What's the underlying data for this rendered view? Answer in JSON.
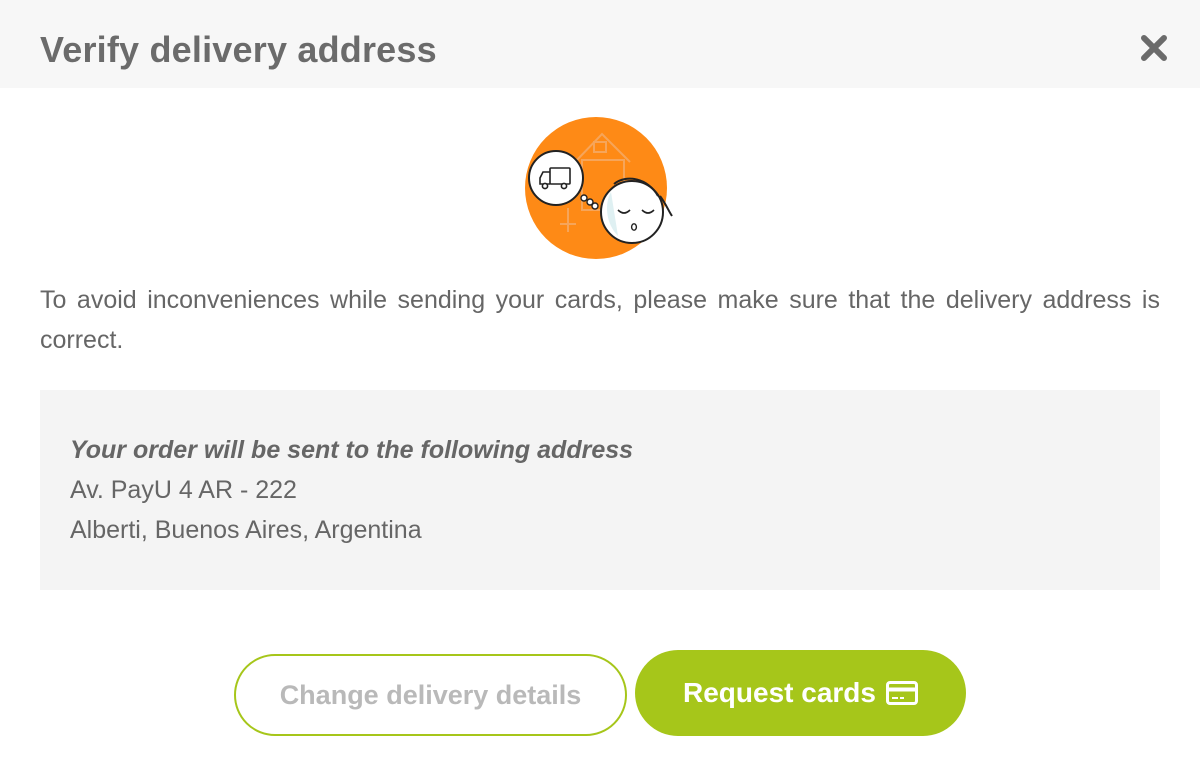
{
  "dialog": {
    "title": "Verify delivery address",
    "close_icon": "close-icon",
    "illustration_icon": "delivery-truck-illustration"
  },
  "intro": {
    "text": "To avoid inconveniences while sending your cards, please make sure that the delivery address is correct."
  },
  "address": {
    "heading": "Your order will be sent to the following address",
    "line1": "Av. PayU 4 AR - 222",
    "line2": "Alberti, Buenos Aires, Argentina"
  },
  "actions": {
    "change_label": "Change delivery details",
    "request_label": "Request cards",
    "request_icon": "credit-card-icon"
  },
  "colors": {
    "accent": "#a6c61a",
    "illustration_orange": "#fe8a16",
    "text": "#666666",
    "header_bg": "#f7f7f7",
    "panel_bg": "#f4f4f4"
  }
}
